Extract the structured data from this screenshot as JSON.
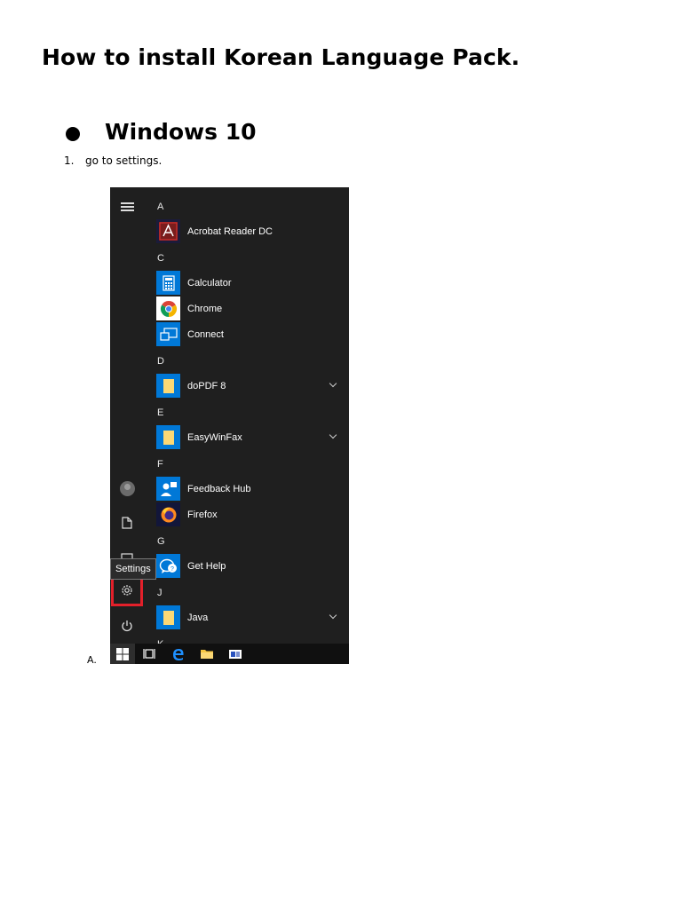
{
  "document": {
    "title": "How to install Korean Language Pack.",
    "section": "Windows 10",
    "step_number": "1.",
    "step_text": "go to settings.",
    "sub_letter": "A."
  },
  "start_menu": {
    "tooltip": "Settings",
    "letters": [
      "A",
      "C",
      "D",
      "E",
      "F",
      "G",
      "J",
      "K"
    ],
    "apps": [
      {
        "label": "Acrobat Reader DC",
        "icon": "acrobat-icon"
      },
      {
        "label": "Calculator",
        "icon": "calculator-icon"
      },
      {
        "label": "Chrome",
        "icon": "chrome-icon"
      },
      {
        "label": "Connect",
        "icon": "connect-icon"
      },
      {
        "label": "doPDF 8",
        "icon": "folder-icon",
        "expandable": true
      },
      {
        "label": "EasyWinFax",
        "icon": "folder-icon",
        "expandable": true
      },
      {
        "label": "Feedback Hub",
        "icon": "feedback-hub-icon"
      },
      {
        "label": "Firefox",
        "icon": "firefox-icon"
      },
      {
        "label": "Get Help",
        "icon": "get-help-icon"
      },
      {
        "label": "Java",
        "icon": "folder-icon",
        "expandable": true
      }
    ],
    "colors": {
      "highlight": "#e3202a",
      "tile_blue": "#0078d7",
      "background": "#1f1f1f"
    }
  }
}
